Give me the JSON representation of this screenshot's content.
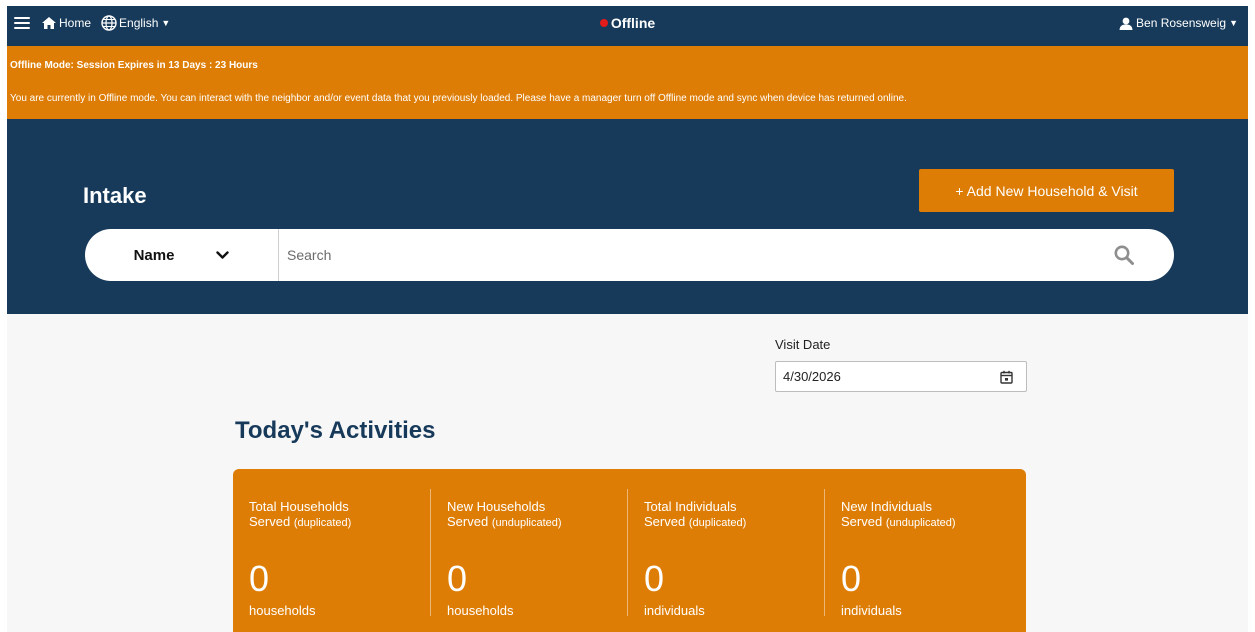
{
  "nav": {
    "home_label": "Home",
    "language_label": "English",
    "status_label": "Offline",
    "user_label": "Ben Rosensweig",
    "status_color": "#e21b1b"
  },
  "banner": {
    "title": "Offline Mode: Session Expires in 13 Days : 23 Hours",
    "message": "You are currently in Offline mode. You can interact with the neighbor and/or event data that you previously loaded. Please have a manager turn off Offline mode and sync when device has returned online."
  },
  "hero": {
    "title": "Intake",
    "add_button_label": "+ Add New Household & Visit",
    "search_type_label": "Name",
    "search_placeholder": "Search",
    "search_value": ""
  },
  "visit": {
    "label": "Visit Date",
    "value": "4/30/2026"
  },
  "activities": {
    "title": "Today's Activities",
    "stats": [
      {
        "title": "Total Households",
        "served": "Served",
        "qualifier": "(duplicated)",
        "value": "0",
        "unit": "households"
      },
      {
        "title": "New Households",
        "served": "Served",
        "qualifier": "(unduplicated)",
        "value": "0",
        "unit": "households"
      },
      {
        "title": "Total Individuals",
        "served": "Served",
        "qualifier": "(duplicated)",
        "value": "0",
        "unit": "individuals"
      },
      {
        "title": "New Individuals",
        "served": "Served",
        "qualifier": "(unduplicated)",
        "value": "0",
        "unit": "individuals"
      }
    ]
  },
  "colors": {
    "navy": "#173a5b",
    "orange": "#dd7d06",
    "content_bg": "#f7f7f7"
  },
  "icons": [
    "menu-icon",
    "home-icon",
    "globe-icon",
    "caret-down-icon",
    "user-icon",
    "chevron-down-icon",
    "search-icon",
    "calendar-icon"
  ]
}
